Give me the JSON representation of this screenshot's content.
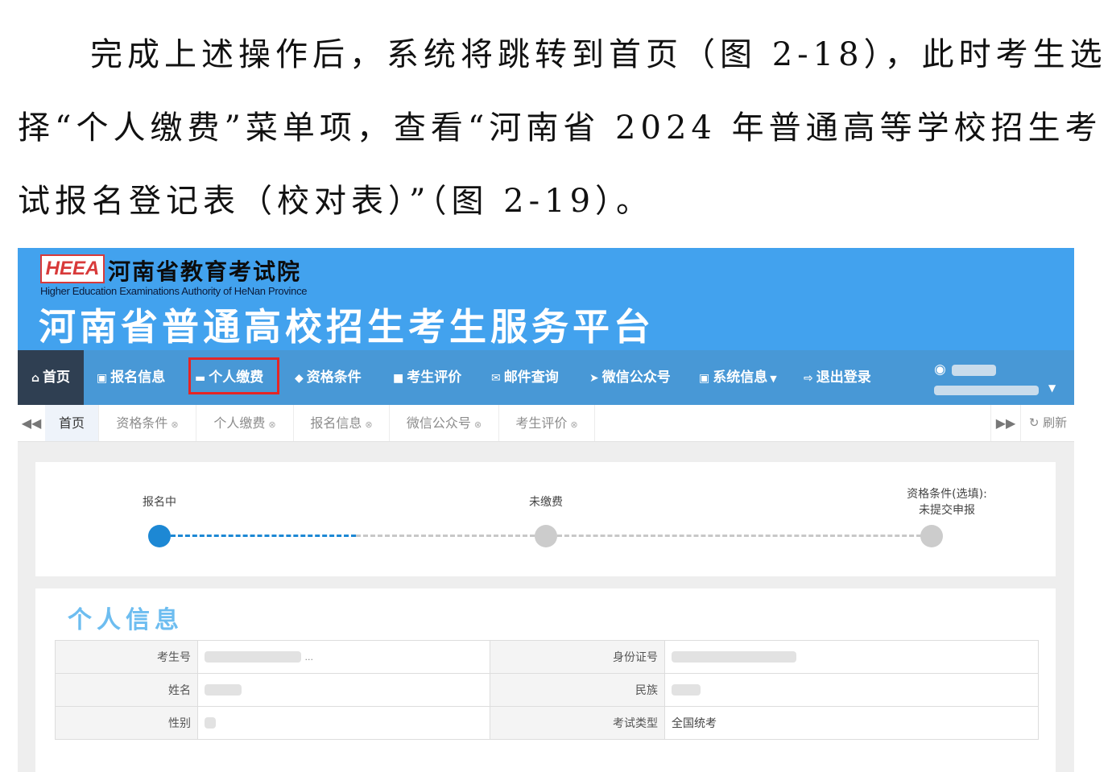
{
  "paragraph": [
    "完成上述操作后，系统将跳转到首页（图 2-18），此时考生选",
    "择“个人缴费”菜单项，查看“河南省 2024 年普通高等学校招生考",
    "试报名登记表（校对表）”（图 2-19）。"
  ],
  "header": {
    "logo_text": "HEEA",
    "institution": "河南省教育考试院",
    "institution_en": "Higher Education Examinations Authority of HeNan Province",
    "platform": "河南省普通高校招生考生服务平台"
  },
  "nav": {
    "home": "首页",
    "items": [
      "报名信息",
      "个人缴费",
      "资格条件",
      "考生评价",
      "邮件查询",
      "微信公众号",
      "系统信息",
      "退出登录"
    ],
    "highlight_color": "#e52525"
  },
  "tabs": {
    "items": [
      "首页",
      "资格条件",
      "个人缴费",
      "报名信息",
      "微信公众号",
      "考生评价"
    ],
    "refresh": "刷新"
  },
  "progress": {
    "steps": [
      "报名中",
      "未缴费",
      "资格条件(选填):\n未提交申报"
    ],
    "active_index": 0
  },
  "personal": {
    "title": "个人信息",
    "rows": [
      {
        "label_left": "考生号",
        "label_right": "身份证号",
        "value_right": ""
      },
      {
        "label_left": "姓名",
        "label_right": "民族",
        "value_right": ""
      },
      {
        "label_left": "性别",
        "label_right": "考试类型",
        "value_right": "全国统考"
      }
    ],
    "masked_hint": "..."
  },
  "colors": {
    "banner": "#42a2ee",
    "nav": "#4898d6",
    "accent": "#1d88d4"
  }
}
